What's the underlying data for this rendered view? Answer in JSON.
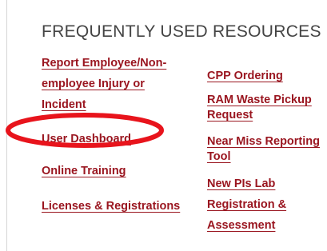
{
  "section": {
    "heading": "FREQUENTLY USED RESOURCES"
  },
  "links_left": [
    "Report Employee/Non-employee Injury or Incident",
    "User Dashboard",
    "Online Training",
    "Licenses & Registrations"
  ],
  "links_right": [
    "CPP Ordering",
    "RAM Waste Pickup Request",
    "Near Miss Reporting Tool",
    "New PIs Lab Registration & Assessment"
  ],
  "left_lines": {
    "injury_1": "Report Employee/Non-",
    "injury_2": "employee Injury or",
    "injury_3": "Incident"
  },
  "right_lines": {
    "ram_1": "RAM Waste Pickup",
    "ram_2": "Request",
    "near_1": "Near Miss Reporting",
    "near_2": "Tool",
    "pis_1": "New PIs Lab",
    "pis_2": "Registration &",
    "pis_3": "Assessment"
  },
  "colors": {
    "link": "#9a1620",
    "heading": "#444444",
    "annotation_ellipse": "#e8141c"
  }
}
